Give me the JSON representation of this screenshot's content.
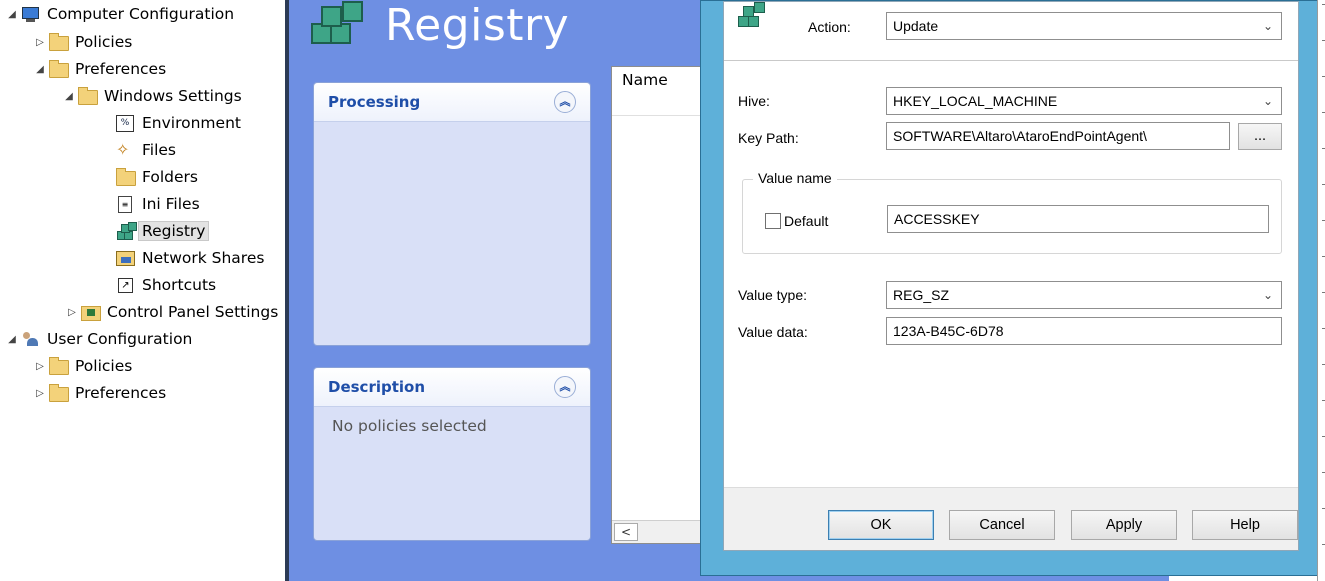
{
  "tree": {
    "items": [
      {
        "label": "Computer Configuration",
        "expander": "open"
      },
      {
        "label": "Policies",
        "expander": "closed"
      },
      {
        "label": "Preferences",
        "expander": "open"
      },
      {
        "label": "Windows Settings",
        "expander": "open"
      },
      {
        "label": "Environment",
        "icon_text": "%"
      },
      {
        "label": "Files"
      },
      {
        "label": "Folders"
      },
      {
        "label": "Ini Files"
      },
      {
        "label": "Registry",
        "selected": true
      },
      {
        "label": "Network Shares"
      },
      {
        "label": "Shortcuts"
      },
      {
        "label": "Control Panel Settings",
        "expander": "closed"
      },
      {
        "label": "User Configuration",
        "expander": "open"
      },
      {
        "label": "Policies",
        "expander": "closed"
      },
      {
        "label": "Preferences",
        "expander": "closed"
      }
    ]
  },
  "center": {
    "title": "Registry",
    "processing": {
      "title": "Processing"
    },
    "description": {
      "title": "Description",
      "body": "No policies selected"
    },
    "listview": {
      "name_header": "Name"
    }
  },
  "dialog": {
    "action_label": "Action:",
    "action_value": "Update",
    "hive_label": "Hive:",
    "hive_value": "HKEY_LOCAL_MACHINE",
    "keypath_label": "Key Path:",
    "keypath_value": "SOFTWARE\\Altaro\\AtaroEndPointAgent\\",
    "browse_label": "...",
    "value_name_group": "Value name",
    "default_label": "Default",
    "value_name_value": "ACCESSKEY",
    "value_type_label": "Value type:",
    "value_type_value": "REG_SZ",
    "value_data_label": "Value data:",
    "value_data_value": "123A-B45C-6D78",
    "buttons": {
      "ok": "OK",
      "cancel": "Cancel",
      "apply": "Apply",
      "help": "Help"
    }
  },
  "colors": {
    "center_bg": "#6e8fe3",
    "panel_title": "#1f4ea8",
    "dialog_frame": "#5eb0d9"
  }
}
